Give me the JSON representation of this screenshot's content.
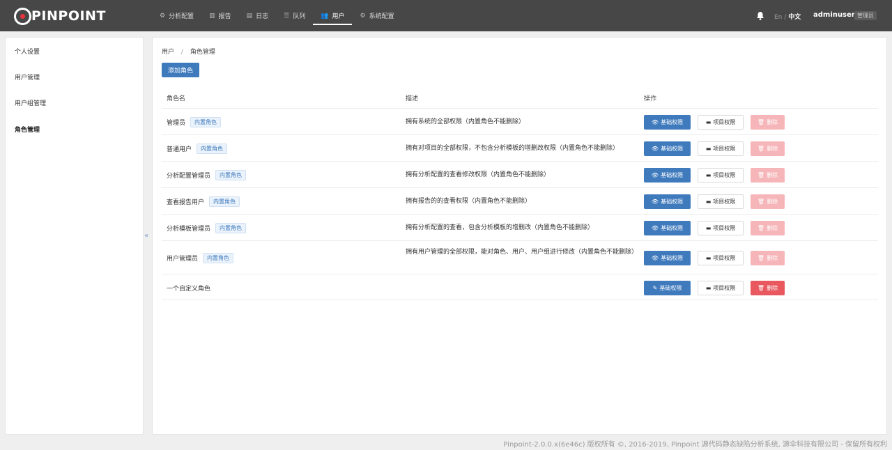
{
  "app": {
    "logo_text": "PINPOINT"
  },
  "nav": {
    "items": [
      {
        "label": "分析配置",
        "icon": "gear-icon",
        "glyph": "⚙"
      },
      {
        "label": "报告",
        "icon": "bar-chart-icon",
        "glyph": "▥"
      },
      {
        "label": "日志",
        "icon": "file-icon",
        "glyph": "▤"
      },
      {
        "label": "队列",
        "icon": "list-icon",
        "glyph": "☰"
      },
      {
        "label": "用户",
        "icon": "users-icon",
        "glyph": "👥"
      },
      {
        "label": "系统配置",
        "icon": "gear-icon",
        "glyph": "⚙"
      }
    ],
    "active_index": 4
  },
  "header": {
    "lang_en": "En",
    "lang_sep": "/",
    "lang_zh": "中文",
    "username": "adminuser",
    "role_badge": "管理员"
  },
  "sidebar": {
    "items": [
      {
        "label": "个人设置"
      },
      {
        "label": "用户管理"
      },
      {
        "label": "用户组管理"
      },
      {
        "label": "角色管理"
      }
    ],
    "active_index": 3,
    "collapse_glyph": "«"
  },
  "breadcrumb": {
    "parent": "用户",
    "separator": "/",
    "current": "角色管理"
  },
  "toolbar": {
    "add_role_label": "添加角色"
  },
  "table": {
    "headers": {
      "name": "角色名",
      "desc": "描述",
      "actions": "操作"
    },
    "builtin_tag": "内置角色",
    "btn_basic": "基础权限",
    "btn_project": "项目权限",
    "btn_delete": "删除",
    "rows": [
      {
        "name": "管理员",
        "builtin": true,
        "desc": "拥有系统的全部权限（内置角色不能删除）"
      },
      {
        "name": "普通用户",
        "builtin": true,
        "desc": "拥有对项目的全部权限，不包含分析模板的增删改权限（内置角色不能删除）"
      },
      {
        "name": "分析配置管理员",
        "builtin": true,
        "desc": "拥有分析配置的查看修改权限（内置角色不能删除）"
      },
      {
        "name": "查看报告用户",
        "builtin": true,
        "desc": "拥有报告的的查看权限（内置角色不能删除）"
      },
      {
        "name": "分析模板管理员",
        "builtin": true,
        "desc": "拥有分析配置的查看，包含分析模板的增删改（内置角色不能删除）"
      },
      {
        "name": "用户管理员",
        "builtin": true,
        "desc": "拥有用户管理的全部权限，能对角色、用户、用户组进行修改（内置角色不能删除）"
      },
      {
        "name": "一个自定义角色",
        "builtin": false,
        "desc": ""
      }
    ]
  },
  "footer": {
    "text": "Pinpoint-2.0.0.x(6e46c) 版权所有 ©, 2016-2019, Pinpoint 源代码静态缺陷分析系统, 源伞科技有限公司 - 保留所有权利"
  }
}
